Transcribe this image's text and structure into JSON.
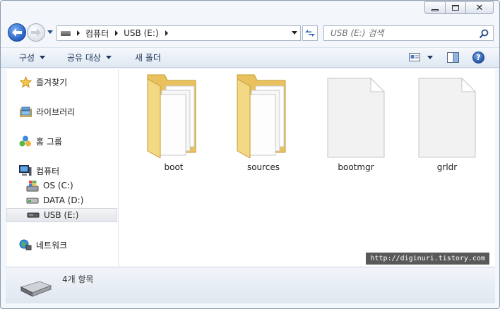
{
  "window": {
    "caption_close": "✕"
  },
  "address_bar": {
    "crumbs": [
      "컴퓨터",
      "USB (E:)"
    ]
  },
  "search": {
    "placeholder": "USB (E:) 검색"
  },
  "toolbar": {
    "organize": "구성",
    "share": "공유 대상",
    "new_folder": "새 폴더",
    "help": "?"
  },
  "nav_pane": {
    "favorites": "즐겨찾기",
    "libraries": "라이브러리",
    "homegroup": "홈 그룹",
    "computer": "컴퓨터",
    "drives": [
      "OS (C:)",
      "DATA (D:)",
      "USB (E:)"
    ],
    "selected_drive": "USB (E:)",
    "network": "네트워크"
  },
  "items": [
    {
      "name": "boot",
      "type": "folder"
    },
    {
      "name": "sources",
      "type": "folder"
    },
    {
      "name": "bootmgr",
      "type": "file"
    },
    {
      "name": "grldr",
      "type": "file"
    }
  ],
  "watermark": "http://diginuri.tistory.com",
  "details": {
    "count": "4개 항목"
  },
  "colors": {
    "accent": "#2a64c6",
    "folder": "#f2d57e",
    "toolbar_text": "#1e395b"
  }
}
